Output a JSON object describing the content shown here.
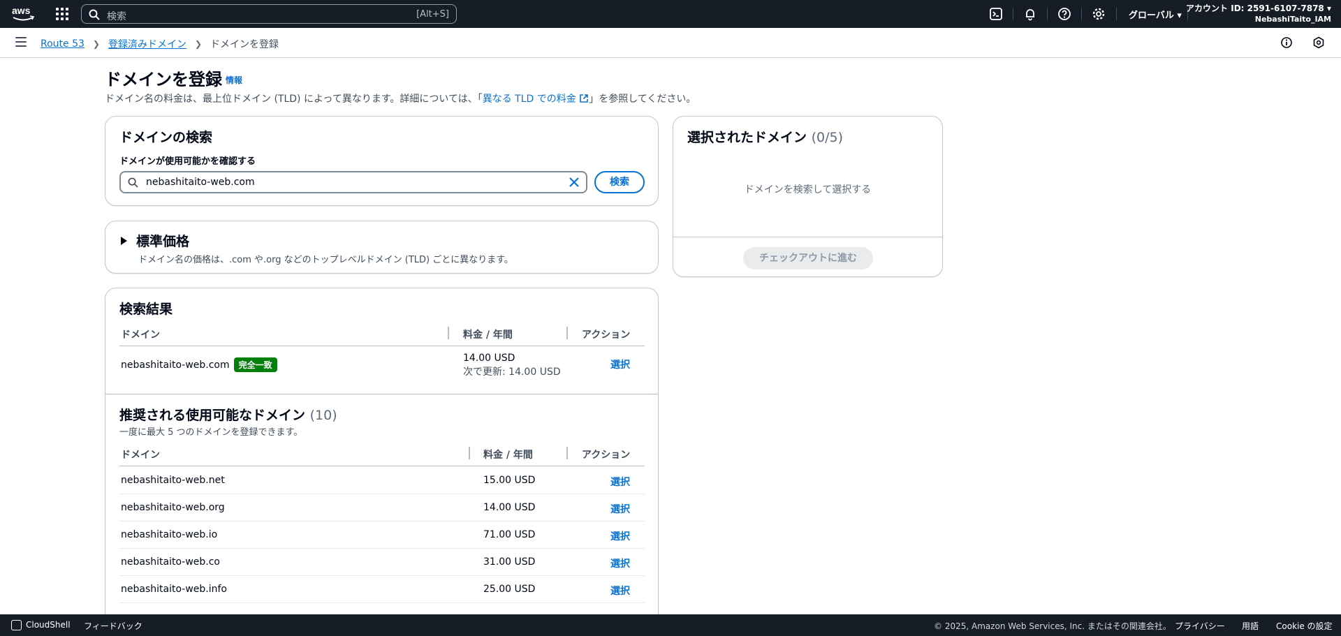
{
  "topnav": {
    "search_placeholder": "検索",
    "search_shortcut": "[Alt+S]",
    "region_label": "グローバル ▾",
    "account_label": "アカウント ID: 2591-6107-7878 ▾",
    "user_label": "NebashiTaito_IAM",
    "icons": [
      "cloudshell-icon",
      "bell-icon",
      "help-icon",
      "gear-icon"
    ]
  },
  "breadcrumb": {
    "items": [
      "Route 53",
      "登録済みドメイン",
      "ドメインを登録"
    ]
  },
  "header": {
    "title": "ドメインを登録",
    "info": "情報",
    "desc_before": "ドメイン名の料金は、最上位ドメイン (TLD) によって異なります。詳細については、「",
    "desc_link": "異なる TLD での料金",
    "desc_after": "」を参照してください。"
  },
  "search_card": {
    "title": "ドメインの検索",
    "field_label": "ドメインが使用可能かを確認する",
    "input_value": "nebashitaito-web.com",
    "search_button": "検索"
  },
  "pricing_card": {
    "title": "標準価格",
    "desc": "ドメイン名の価格は、.com や.org などのトップレベルドメイン (TLD) ごとに異なります。"
  },
  "results": {
    "title": "検索結果",
    "headers": {
      "domain": "ドメイン",
      "price": "料金 / 年間",
      "action": "アクション"
    },
    "exact": {
      "domain": "nebashitaito-web.com",
      "badge": "完全一致",
      "price": "14.00 USD",
      "renew": "次で更新: 14.00 USD",
      "action": "選択"
    }
  },
  "suggested": {
    "title": "推奨される使用可能なドメイン",
    "count": "(10)",
    "desc": "一度に最大 5 つのドメインを登録できます。",
    "headers": {
      "domain": "ドメイン",
      "price": "料金 / 年間",
      "action": "アクション"
    },
    "rows": [
      {
        "domain": "nebashitaito-web.net",
        "price": "15.00 USD",
        "action": "選択"
      },
      {
        "domain": "nebashitaito-web.org",
        "price": "14.00 USD",
        "action": "選択"
      },
      {
        "domain": "nebashitaito-web.io",
        "price": "71.00 USD",
        "action": "選択"
      },
      {
        "domain": "nebashitaito-web.co",
        "price": "31.00 USD",
        "action": "選択"
      },
      {
        "domain": "nebashitaito-web.info",
        "price": "25.00 USD",
        "action": "選択"
      }
    ]
  },
  "selected_card": {
    "title": "選択されたドメイン",
    "count": "(0/5)",
    "empty": "ドメインを検索して選択する",
    "checkout": "チェックアウトに進む"
  },
  "footer": {
    "cloudshell": "CloudShell",
    "feedback": "フィードバック",
    "copyright": "© 2025, Amazon Web Services, Inc. またはその関連会社。",
    "privacy": "プライバシー",
    "terms": "用語",
    "cookie": "Cookie の設定"
  },
  "colors": {
    "nav_bg": "#161d26",
    "link": "#0972d3",
    "badge_success": "#037f0c"
  }
}
